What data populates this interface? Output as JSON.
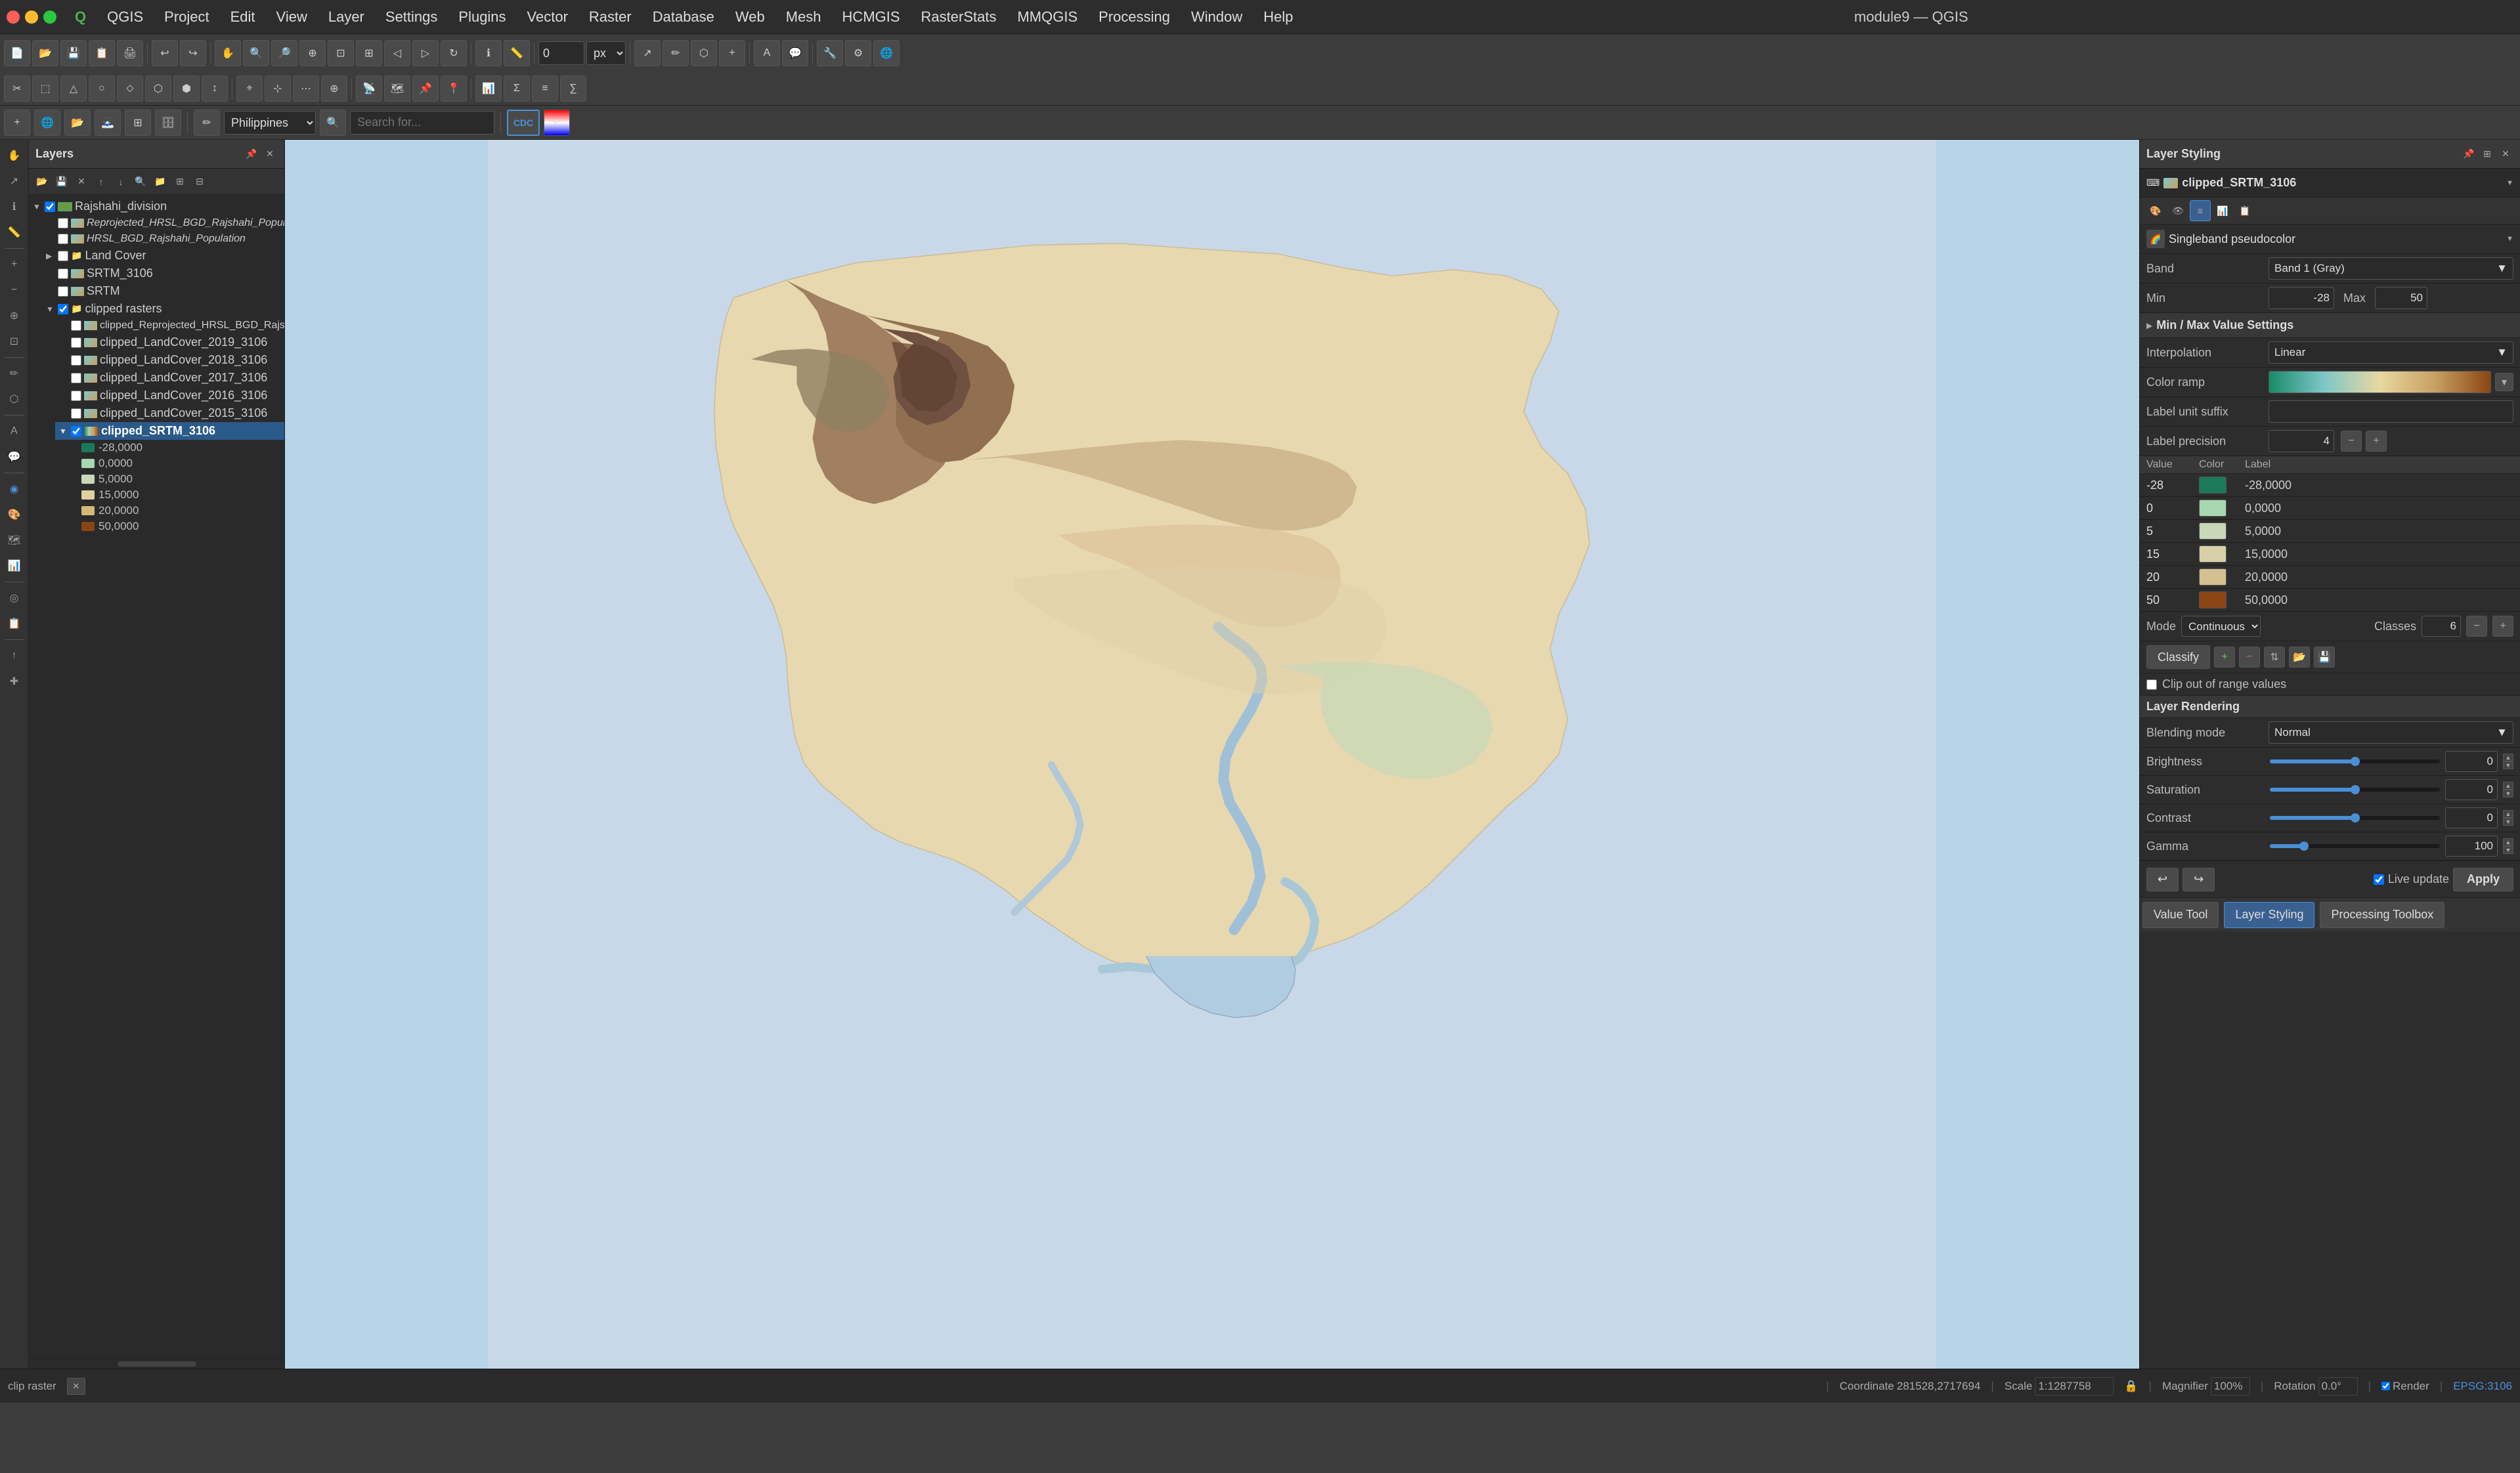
{
  "app": {
    "name": "QGIS",
    "module_title": "module9 — QGIS",
    "logo": "Q"
  },
  "menubar": {
    "items": [
      "QGIS",
      "Project",
      "Edit",
      "View",
      "Layer",
      "Settings",
      "Plugins",
      "Vector",
      "Raster",
      "Database",
      "Web",
      "Mesh",
      "HCMGIS",
      "RasterStats",
      "MMQGIS",
      "Processing",
      "Window",
      "Help"
    ]
  },
  "toolbar": {
    "rotation_value": "0",
    "rotation_unit": "px",
    "search_placeholder": "Search for...",
    "location": "Philippines"
  },
  "layers_panel": {
    "title": "Layers",
    "layers": [
      {
        "name": "Rajshahi_division",
        "type": "vector",
        "checked": true,
        "indent": 0,
        "expanded": true
      },
      {
        "name": "Reprojected_HRSL_BGD_Rajshahi_Populati",
        "type": "raster",
        "checked": false,
        "indent": 1,
        "italic": true
      },
      {
        "name": "HRSL_BGD_Rajshahi_Population",
        "type": "raster",
        "checked": false,
        "indent": 1,
        "italic": true
      },
      {
        "name": "Land Cover",
        "type": "group",
        "checked": false,
        "indent": 1,
        "expanded": false
      },
      {
        "name": "SRTM_3106",
        "type": "raster",
        "checked": false,
        "indent": 1
      },
      {
        "name": "SRTM",
        "type": "raster",
        "checked": false,
        "indent": 1
      },
      {
        "name": "clipped rasters",
        "type": "group",
        "checked": true,
        "indent": 1,
        "expanded": true
      },
      {
        "name": "clipped_Reprojected_HRSL_BGD_Rajsha...",
        "type": "raster",
        "checked": false,
        "indent": 2
      },
      {
        "name": "clipped_LandCover_2019_3106",
        "type": "raster",
        "checked": false,
        "indent": 2
      },
      {
        "name": "clipped_LandCover_2018_3106",
        "type": "raster",
        "checked": false,
        "indent": 2
      },
      {
        "name": "clipped_LandCover_2017_3106",
        "type": "raster",
        "checked": false,
        "indent": 2
      },
      {
        "name": "clipped_LandCover_2016_3106",
        "type": "raster",
        "checked": false,
        "indent": 2
      },
      {
        "name": "clipped_LandCover_2015_3106",
        "type": "raster",
        "checked": false,
        "indent": 2
      },
      {
        "name": "clipped_SRTM_3106",
        "type": "raster",
        "checked": true,
        "indent": 2,
        "selected": true,
        "bold": true
      }
    ],
    "legend": [
      {
        "value": "-28,0000",
        "color": "#1a7a5a"
      },
      {
        "value": "0,0000",
        "color": "#a8d8b0"
      },
      {
        "value": "5,0000",
        "color": "#c8d8b8"
      },
      {
        "value": "15,0000",
        "color": "#e0d0a0"
      },
      {
        "value": "20,0000",
        "color": "#d4b878"
      },
      {
        "value": "50,0000",
        "color": "#8b4513"
      }
    ]
  },
  "styling_panel": {
    "title": "Layer Styling",
    "layer_name": "clipped_SRTM_3106",
    "renderer_type": "Singleband pseudocolor",
    "band_label": "Band",
    "band_value": "Band 1 (Gray)",
    "min_label": "Min",
    "min_value": "-28",
    "max_label": "Max",
    "max_value": "50",
    "min_max_section": "Min / Max Value Settings",
    "interpolation_label": "Interpolation",
    "interpolation_value": "Linear",
    "color_ramp_label": "Color ramp",
    "label_unit_suffix_label": "Label unit suffix",
    "label_unit_suffix_value": "",
    "label_precision_label": "Label precision",
    "label_precision_value": "4",
    "table_headers": [
      "Value",
      "Color",
      "Label"
    ],
    "color_entries": [
      {
        "value": "-28",
        "color": "#1a7a5a",
        "label": "-28,0000"
      },
      {
        "value": "0",
        "color": "#a8d8b0",
        "label": "0,0000"
      },
      {
        "value": "5",
        "color": "#c8d8b8",
        "label": "5,0000"
      },
      {
        "value": "15",
        "color": "#d8d0a8",
        "label": "15,0000"
      },
      {
        "value": "20",
        "color": "#d4c090",
        "label": "20,0000"
      },
      {
        "value": "50",
        "color": "#8b4513",
        "label": "50,0000"
      }
    ],
    "mode_label": "Mode",
    "mode_value": "Continuous",
    "classes_label": "Classes",
    "classes_value": "6",
    "classify_btn": "Classify",
    "clip_label": "Clip out of range values",
    "layer_rendering_title": "Layer Rendering",
    "blending_mode_label": "Blending mode",
    "blending_mode_value": "Normal",
    "brightness_label": "Brightness",
    "brightness_value": "0",
    "saturation_label": "Saturation",
    "saturation_value": "0",
    "contrast_label": "Contrast",
    "contrast_value": "0",
    "gamma_label": "Gamma",
    "gamma_value": "100"
  },
  "bottom_bar": {
    "value_tool_label": "Value Tool",
    "layer_styling_label": "Layer Styling",
    "processing_toolbox_label": "Processing Toolbox",
    "live_update_label": "Live update",
    "apply_label": "Apply"
  },
  "status_bar": {
    "clip_label": "clip raster",
    "coordinate_label": "Coordinate",
    "coordinate_value": "281528,2717694",
    "scale_label": "Scale",
    "scale_value": "1:1287758",
    "magnifier_label": "Magnifier",
    "magnifier_value": "100%",
    "rotation_label": "Rotation",
    "rotation_value": "0.0°",
    "render_label": "Render",
    "epsg_label": "EPSG:3106"
  }
}
